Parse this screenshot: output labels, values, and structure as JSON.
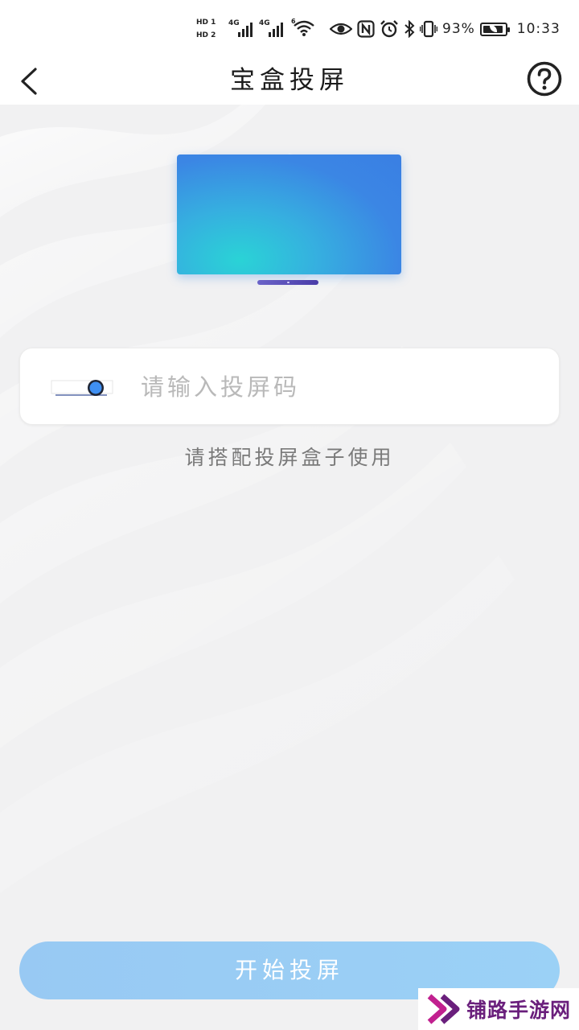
{
  "status_bar": {
    "hd1": "HD 1",
    "hd2": "HD 2",
    "net1": "4G",
    "net2": "4G",
    "wifi": "6",
    "battery_percent": "93%",
    "battery_level": 0.93,
    "time": "10:33",
    "icons": [
      "eye-icon",
      "nfc-icon",
      "alarm-icon",
      "bluetooth-icon",
      "vibrate-icon",
      "wifi-icon",
      "battery-icon"
    ]
  },
  "nav": {
    "title": "宝盒投屏",
    "back_icon": "chevron-left-icon",
    "help_icon": "question-circle-icon"
  },
  "input": {
    "placeholder": "请输入投屏码",
    "value": ""
  },
  "hint": "请搭配投屏盒子使用",
  "start_button": "开始投屏",
  "watermark": {
    "text": "铺路手游网"
  },
  "colors": {
    "accent": "#9bcbf4",
    "background": "#f1f1f2",
    "tv_gradient_start": "#2ad3d6",
    "tv_gradient_end": "#3b82e4",
    "watermark": "#6a1f7c"
  }
}
